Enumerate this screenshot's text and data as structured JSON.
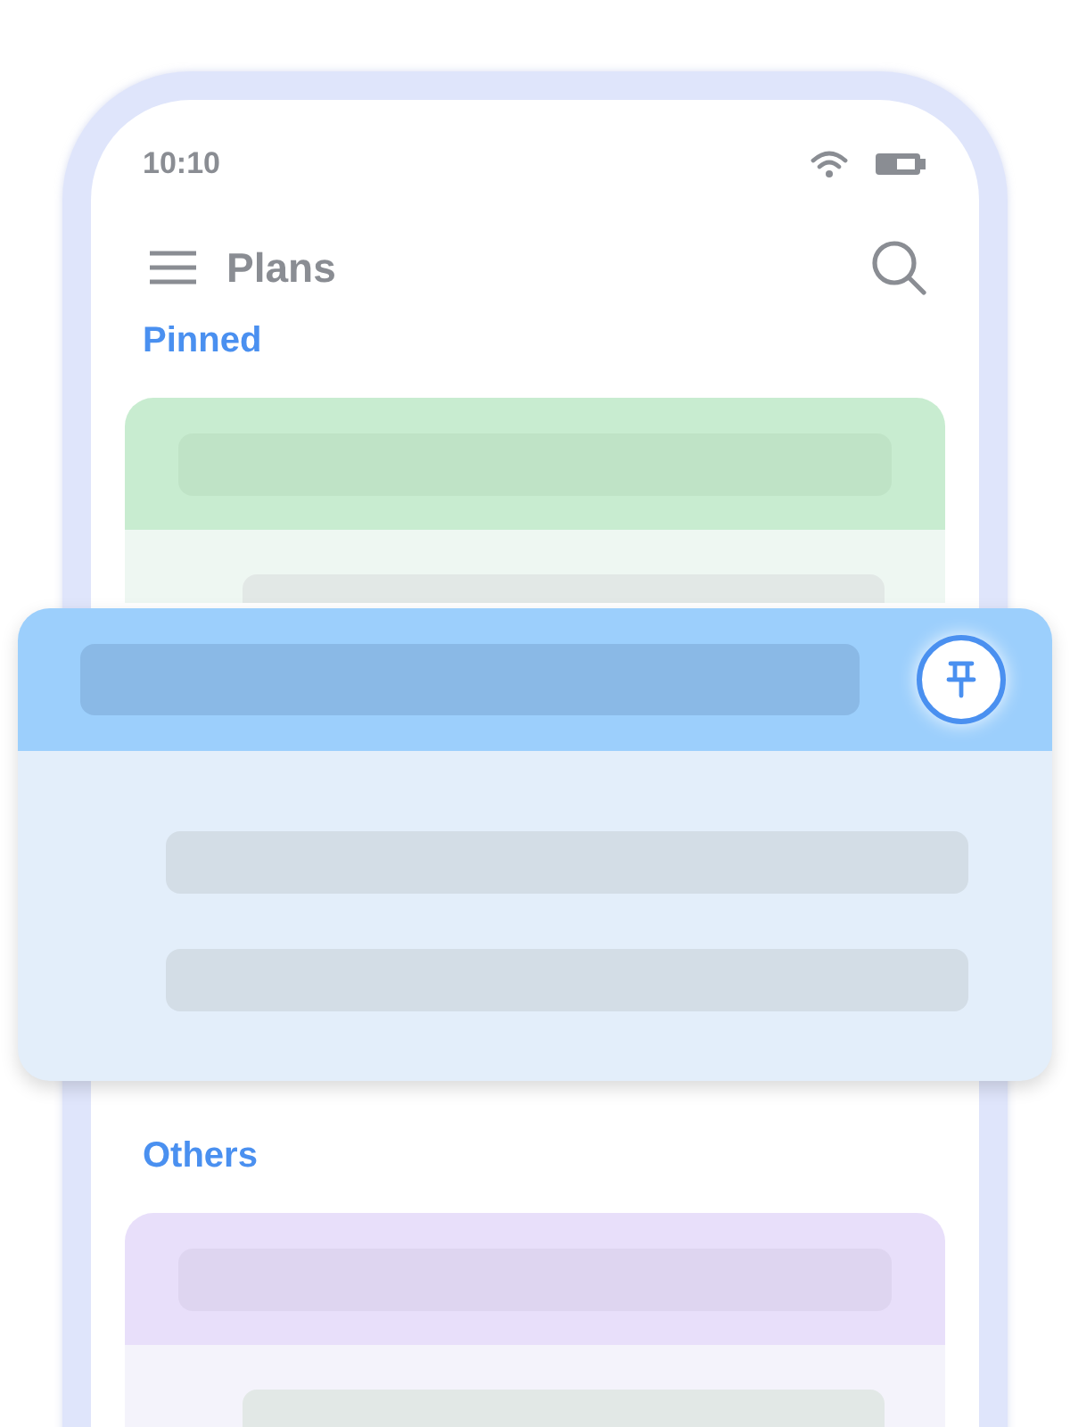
{
  "status_bar": {
    "time": "10:10"
  },
  "header": {
    "title": "Plans"
  },
  "sections": [
    {
      "title": "Pinned",
      "cards": [
        {
          "color": "#c8ecd0"
        }
      ]
    },
    {
      "title": "Others",
      "cards": [
        {
          "color": "#e8dffa"
        }
      ]
    }
  ],
  "floating_card": {
    "pinned": true
  }
}
